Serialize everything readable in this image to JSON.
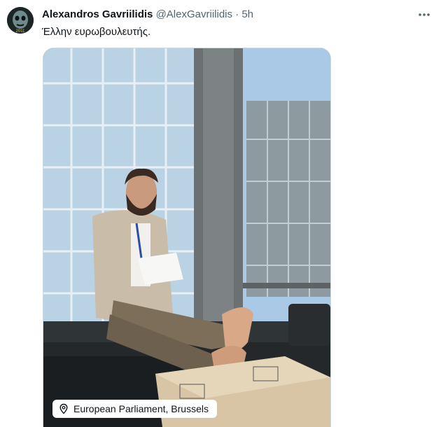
{
  "tweet": {
    "author_name": "Alexandros Gavriilidis",
    "author_handle": "@AlexGavriilidis",
    "separator": "·",
    "time": "5h",
    "text": "Έλλην ευρωβουλευτής.",
    "avatar_caption": "2011",
    "more_icon": "more-dots-icon"
  },
  "media": {
    "location_icon": "location-pin-icon",
    "location_label": "European Parliament, Brussels"
  }
}
